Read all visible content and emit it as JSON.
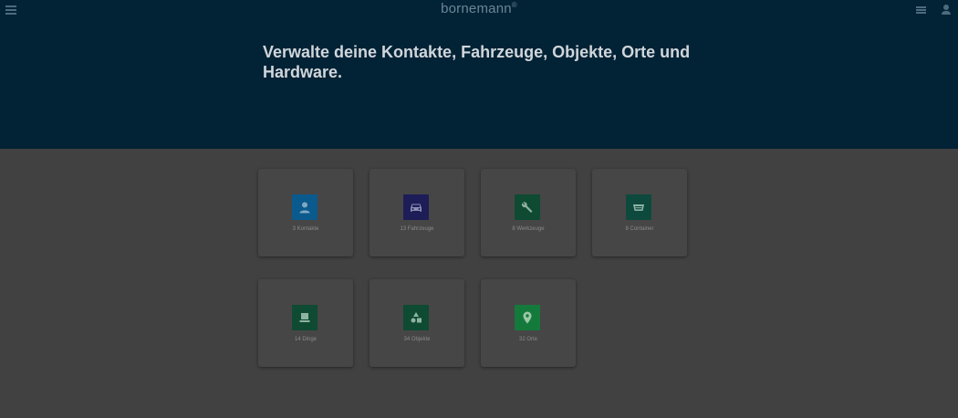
{
  "header": {
    "brand": "bornemann",
    "brand_mark": "®",
    "headline": "Verwalte deine Kontakte, Fahrzeuge, Objekte, Orte und Hardware.",
    "icons": [
      "menu-icon",
      "list-icon",
      "user-icon"
    ]
  },
  "cards": [
    {
      "label": "3 Kontakte",
      "icon": "person-icon",
      "color": "#0b5a8e"
    },
    {
      "label": "13 Fahrzeuge",
      "icon": "car-icon",
      "color": "#1d1d57"
    },
    {
      "label": "8 Werkzeuge",
      "icon": "wrench-icon",
      "color": "#0f4a32"
    },
    {
      "label": "8 Container",
      "icon": "container-icon",
      "color": "#0d4a3d"
    },
    {
      "label": "14 Dinge",
      "icon": "box-icon",
      "color": "#0f4a32"
    },
    {
      "label": "34 Objekte",
      "icon": "shapes-icon",
      "color": "#0f4a32"
    },
    {
      "label": "32 Orte",
      "icon": "location-pin-icon",
      "color": "#147a3b"
    }
  ]
}
